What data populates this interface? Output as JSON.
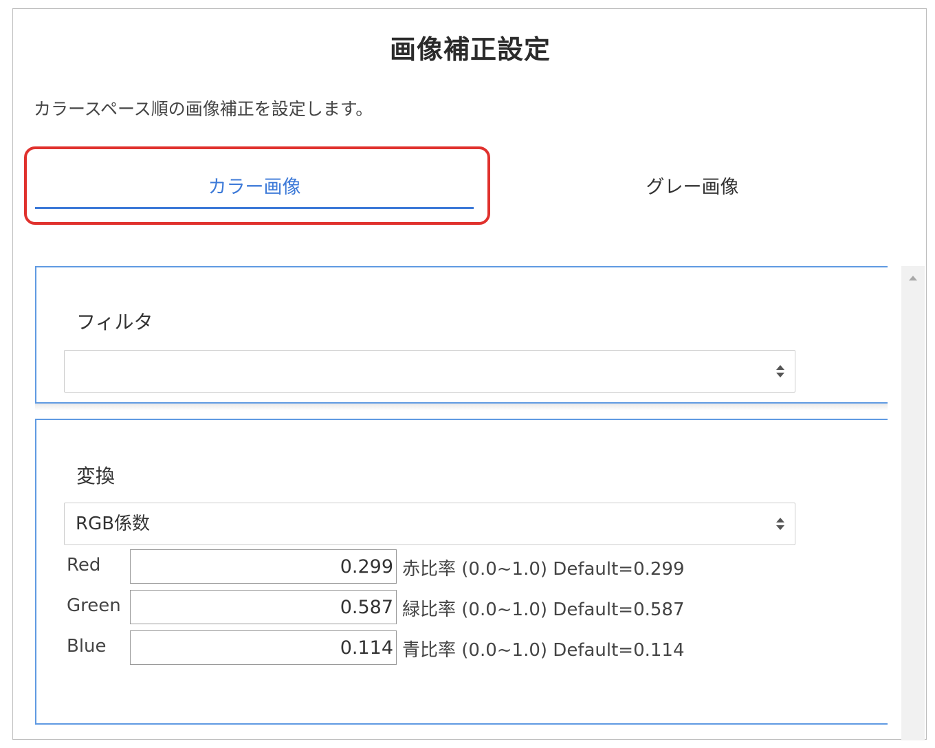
{
  "dialog": {
    "title": "画像補正設定",
    "description": "カラースペース順の画像補正を設定します。"
  },
  "tabs": [
    {
      "label": "カラー画像",
      "active": true
    },
    {
      "label": "グレー画像",
      "active": false
    }
  ],
  "filter": {
    "label": "フィルタ",
    "selected": ""
  },
  "transform": {
    "label": "変換",
    "selected": "RGB係数",
    "rows": [
      {
        "label": "Red",
        "value": "0.299",
        "note": "赤比率 (0.0~1.0) Default=0.299"
      },
      {
        "label": "Green",
        "value": "0.587",
        "note": "緑比率 (0.0~1.0) Default=0.587"
      },
      {
        "label": "Blue",
        "value": "0.114",
        "note": "青比率 (0.0~1.0) Default=0.114"
      }
    ]
  },
  "colors": {
    "accent": "#3d7ad8",
    "highlight": "#e0312d",
    "panel_border": "#5f9ae2"
  }
}
